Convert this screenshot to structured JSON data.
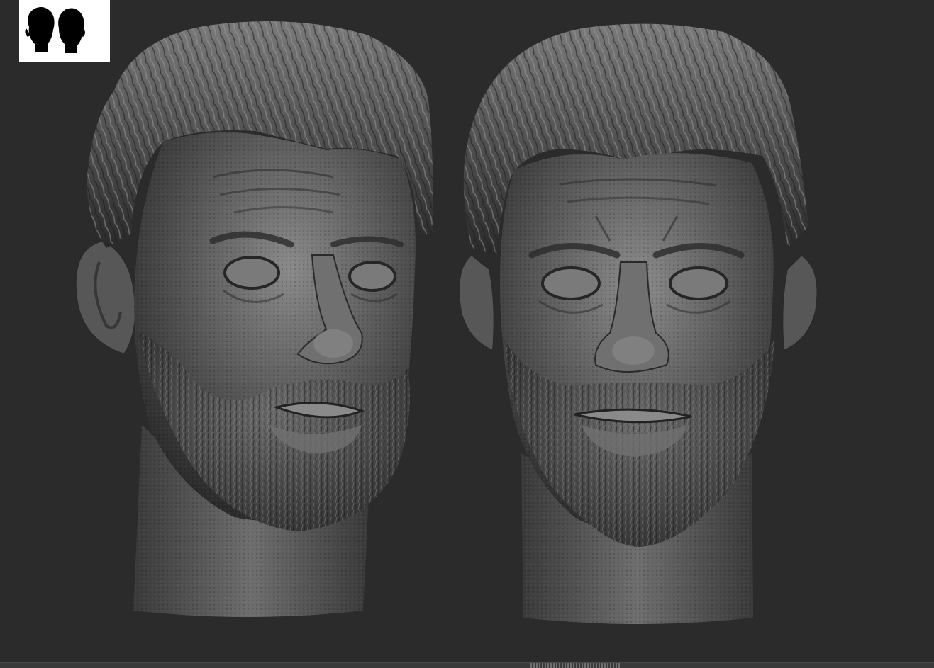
{
  "document": {
    "subject": "sculpt-head-views",
    "views": [
      "front-three-quarter",
      "front"
    ]
  },
  "thumbnail": {
    "icon": "two-head-silhouettes-icon",
    "background": "#ffffff",
    "silhouette_color": "#000000"
  },
  "viewport": {
    "background": "#2b2b2b",
    "border_color": "#6e6e6e"
  },
  "material": {
    "base": "#5a5a5a",
    "shadow": "#1e1e1e",
    "highlight": "#b5b5b5"
  },
  "bottom_bar": {
    "handle_icon": "drag-handle-icon"
  }
}
